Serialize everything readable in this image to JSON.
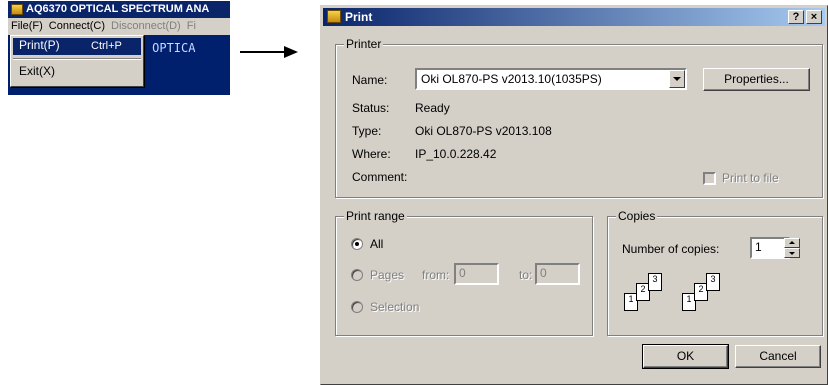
{
  "app": {
    "title": "AQ6370 OPTICAL SPECTRUM ANA",
    "menubar": [
      "File(F)",
      "Connect(C)",
      "Disconnect(D)",
      "Fi"
    ],
    "banner": "6370 OPTICA",
    "file_menu": {
      "print_label": "Print(P)",
      "print_shortcut": "Ctrl+P",
      "exit_label": "Exit(X)"
    }
  },
  "dialog": {
    "title": "Print",
    "help_btn": "?",
    "close_btn": "×",
    "printer": {
      "group_label": "Printer",
      "name_label": "Name:",
      "name_value": "Oki OL870-PS v2013.10(1035PS)",
      "properties_button": "Properties...",
      "status_label": "Status:",
      "status_value": "Ready",
      "type_label": "Type:",
      "type_value": "Oki OL870-PS v2013.108",
      "where_label": "Where:",
      "where_value": "IP_10.0.228.42",
      "comment_label": "Comment:",
      "print_to_file_label": "Print to file"
    },
    "print_range": {
      "group_label": "Print range",
      "all_label": "All",
      "pages_label": "Pages",
      "from_label": "from:",
      "from_value": "0",
      "to_label": "to:",
      "to_value": "0",
      "selection_label": "Selection"
    },
    "copies": {
      "group_label": "Copies",
      "number_label": "Number of copies:",
      "number_value": "1",
      "collate_pages": [
        "1",
        "2",
        "3"
      ]
    },
    "ok_button": "OK",
    "cancel_button": "Cancel"
  }
}
